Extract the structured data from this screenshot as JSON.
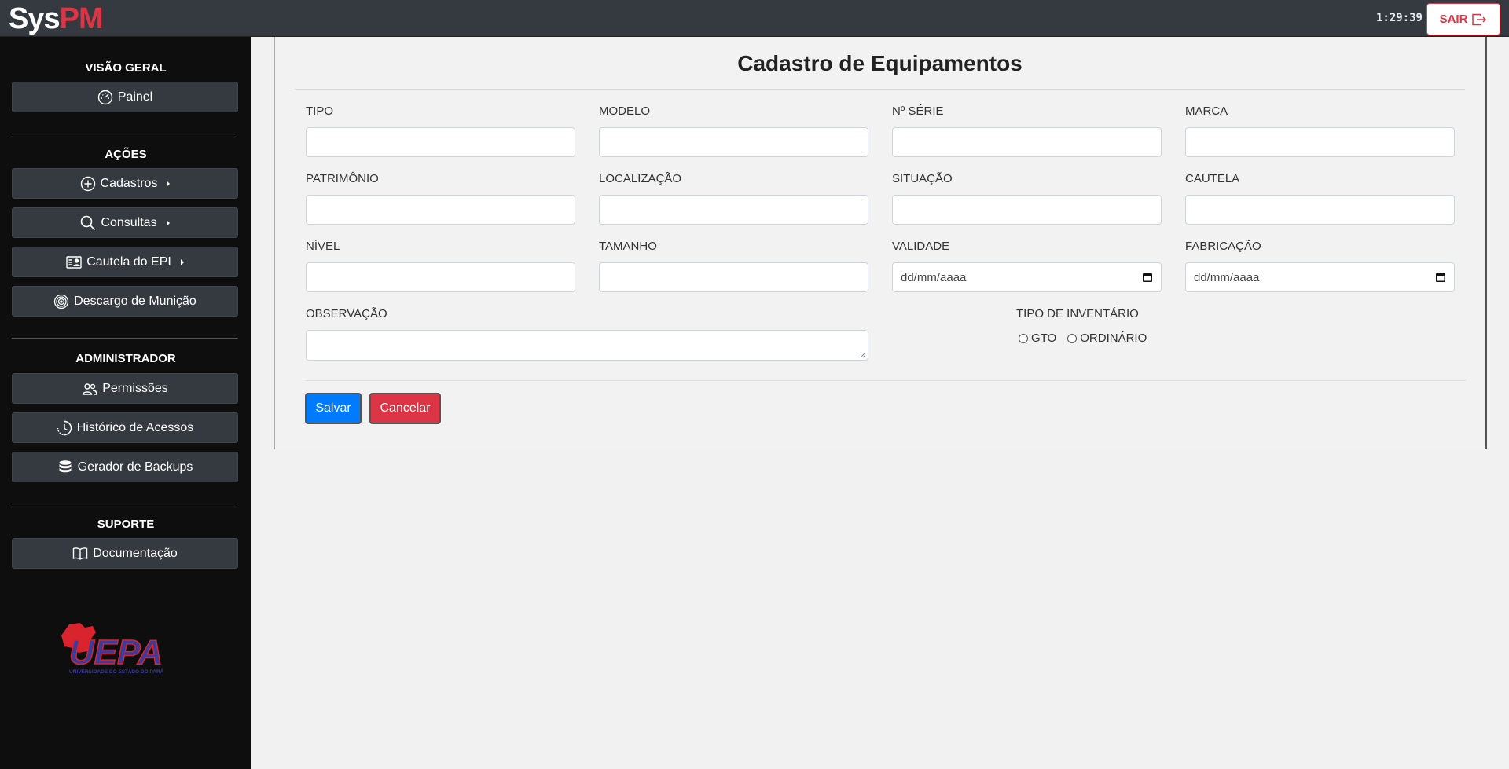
{
  "header": {
    "brand_sys": "Sys",
    "brand_pm": "PM",
    "clock": "1:29:39",
    "logout_label": "SAIR"
  },
  "sidebar": {
    "sections": {
      "overview": "VISÃO GERAL",
      "actions": "AÇÕES",
      "admin": "ADMINISTRADOR",
      "support": "SUPORTE"
    },
    "items": {
      "painel": "Painel",
      "cadastros": "Cadastros",
      "consultas": "Consultas",
      "cautela_epi": "Cautela do EPI",
      "descargo": "Descargo de Munição",
      "permissoes": "Permissões",
      "historico": "Histórico de Acessos",
      "backups": "Gerador de Backups",
      "documentacao": "Documentação"
    },
    "logo_text": "UEPA",
    "logo_subtext": "UNIVERSIDADE DO ESTADO DO PARÁ"
  },
  "form": {
    "title": "Cadastro de Equipamentos",
    "labels": {
      "tipo": "TIPO",
      "modelo": "MODELO",
      "serie": "Nº SÉRIE",
      "marca": "MARCA",
      "patrimonio": "PATRIMÔNIO",
      "localizacao": "LOCALIZAÇÃO",
      "situacao": "SITUAÇÃO",
      "cautela": "CAUTELA",
      "nivel": "NÍVEL",
      "tamanho": "TAMANHO",
      "validade": "VALIDADE",
      "fabricacao": "FABRICAÇÃO",
      "observacao": "OBSERVAÇÃO",
      "tipo_inventario": "TIPO DE INVENTÁRIO"
    },
    "date_placeholder": "dd/mm/aaaa",
    "inventory_options": [
      "GTO",
      "ORDINÁRIO"
    ],
    "save_label": "Salvar",
    "cancel_label": "Cancelar"
  },
  "colors": {
    "brand_red": "#dc3545",
    "primary": "#007bff",
    "sidebar_bg": "#0e0e0e",
    "topbar_bg": "#343a40"
  },
  "icons": {
    "painel": "speedometer-icon",
    "cadastros": "plus-circle-icon",
    "consultas": "search-icon",
    "cautela_epi": "person-badge-icon",
    "descargo": "target-icon",
    "permissoes": "people-icon",
    "historico": "clock-history-icon",
    "backups": "database-icon",
    "documentacao": "book-icon",
    "logout": "box-arrow-right-icon"
  }
}
